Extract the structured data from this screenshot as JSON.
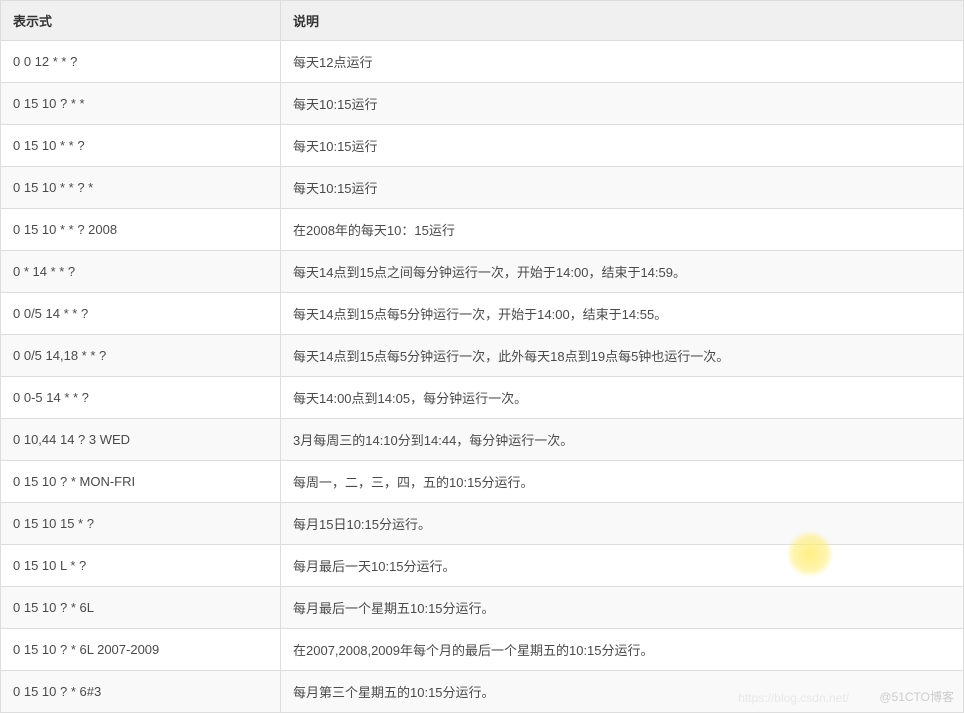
{
  "table": {
    "headers": {
      "expression": "表示式",
      "description": "说明"
    },
    "rows": [
      {
        "expression": "0 0 12 * * ?",
        "description": "每天12点运行"
      },
      {
        "expression": "0 15 10 ? * *",
        "description": "每天10:15运行"
      },
      {
        "expression": "0 15 10 * * ?",
        "description": "每天10:15运行"
      },
      {
        "expression": "0 15 10 * * ? *",
        "description": "每天10:15运行"
      },
      {
        "expression": "0 15 10 * * ? 2008",
        "description": "在2008年的每天10：15运行"
      },
      {
        "expression": "0 * 14 * * ?",
        "description": "每天14点到15点之间每分钟运行一次，开始于14:00，结束于14:59。"
      },
      {
        "expression": "0 0/5 14 * * ?",
        "description": "每天14点到15点每5分钟运行一次，开始于14:00，结束于14:55。"
      },
      {
        "expression": "0 0/5 14,18 * * ?",
        "description": "每天14点到15点每5分钟运行一次，此外每天18点到19点每5钟也运行一次。"
      },
      {
        "expression": "0 0-5 14 * * ?",
        "description": "每天14:00点到14:05，每分钟运行一次。"
      },
      {
        "expression": "0 10,44 14 ? 3 WED",
        "description": "3月每周三的14:10分到14:44，每分钟运行一次。"
      },
      {
        "expression": "0 15 10 ? * MON-FRI",
        "description": "每周一，二，三，四，五的10:15分运行。"
      },
      {
        "expression": "0 15 10 15 * ?",
        "description": "每月15日10:15分运行。"
      },
      {
        "expression": "0 15 10 L * ?",
        "description": "每月最后一天10:15分运行。"
      },
      {
        "expression": "0 15 10 ? * 6L",
        "description": "每月最后一个星期五10:15分运行。"
      },
      {
        "expression": "0 15 10 ? * 6L 2007-2009",
        "description": "在2007,2008,2009年每个月的最后一个星期五的10:15分运行。"
      },
      {
        "expression": "0 15 10 ? * 6#3",
        "description": "每月第三个星期五的10:15分运行。"
      }
    ]
  },
  "watermarks": {
    "left": "https://blog.csdn.net/",
    "right": "@51CTO博客"
  }
}
